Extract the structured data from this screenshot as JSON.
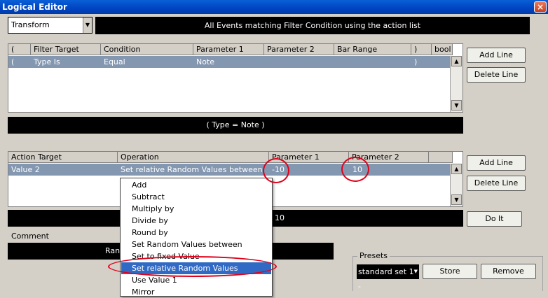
{
  "window": {
    "title": "Logical Editor",
    "close": "×"
  },
  "mode": {
    "value": "Transform",
    "description": "All Events matching Filter Condition using the action list"
  },
  "filter": {
    "headers": [
      "(",
      "Filter Target",
      "Condition",
      "Parameter 1",
      "Parameter 2",
      "Bar Range",
      ")",
      "bool"
    ],
    "row": [
      "(",
      "Type Is",
      "Equal",
      "Note",
      "",
      "",
      ")",
      ""
    ],
    "summary": "(    Type = Note   )",
    "add_line": "Add Line",
    "delete_line": "Delete Line"
  },
  "action": {
    "headers": [
      "Action Target",
      "Operation",
      "Parameter 1",
      "Parameter 2"
    ],
    "row": [
      "Value 2",
      "Set relative Random Values between",
      "-10",
      "10"
    ],
    "summary_tail": "10",
    "add_line": "Add Line",
    "delete_line": "Delete Line",
    "do_it": "Do It"
  },
  "comment": {
    "label": "Comment",
    "text_visible": "Ran"
  },
  "operation_menu": {
    "items": [
      "Add",
      "Subtract",
      "Multiply by",
      "Divide by",
      "Round by",
      "Set Random Values between",
      "Set to fixed Value",
      "Set relative Random Values between",
      "Use Value 1",
      "Mirror"
    ],
    "selected_index": 7
  },
  "presets": {
    "label": "Presets",
    "value": "standard set 1 -",
    "store": "Store",
    "remove": "Remove"
  },
  "scroll_icons": {
    "up": "scroll-up-icon",
    "down": "scroll-down-icon"
  },
  "colors": {
    "title_bar": "#0044c2",
    "selected_row": "#8497b0",
    "menu_highlight": "#316ac5",
    "annotation": "#e0001a"
  }
}
